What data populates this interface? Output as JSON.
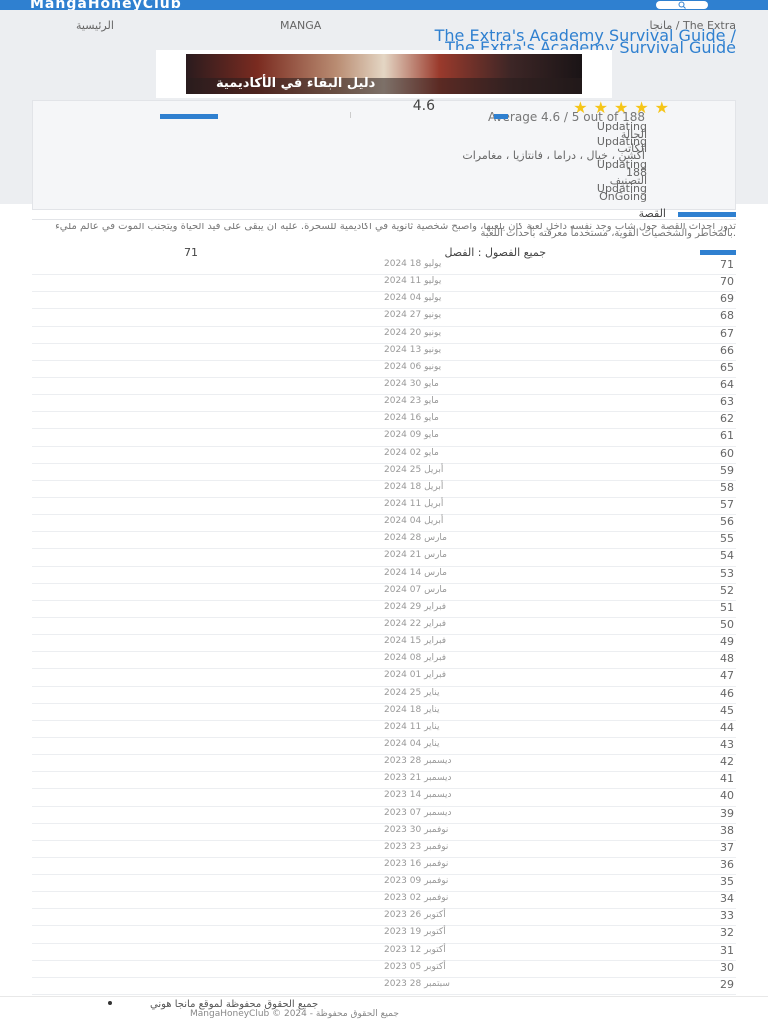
{
  "header": {
    "logo": "MangaHoneyClub",
    "accent": "#2f80d0"
  },
  "breadcrumb": {
    "home": "الرئيسية",
    "section": "MANGA",
    "current": "مانجا / The Extra"
  },
  "title": {
    "main": "The Extra's Academy Survival Guide /",
    "sub": "The Extra's Academy Survival Guide"
  },
  "cover": {
    "title": "دليل البقاء في الأكاديمية"
  },
  "rating": {
    "score": "4.6",
    "stars": "★★★★★",
    "average": "Average 4.6 / 5 out of 188"
  },
  "meta": {
    "lines": [
      "Updating",
      "الحالة",
      "Updating",
      "الكاتب",
      "Updating",
      "الرسام"
    ],
    "genres": "أكشن ، خيال ، دراما ، فانتازيا ، مغامرات",
    "lines2": [
      "Updating",
      "188",
      "التصنيف",
      "Updating",
      "OnGoing"
    ]
  },
  "sections": {
    "story_label": "القصة",
    "story_text": "تدور أحداث القصة حول شاب وجد نفسه داخل لعبة كان يلعبها، وأصبح شخصية ثانوية في أكاديمية للسحرة. عليه أن يبقى على قيد الحياة ويتجنب الموت في عالم مليء بالمخاطر والشخصيات القوية، مستخدماً معرفته بأحداث اللعبة.",
    "chapters_label": "جميع الفصول : الفصل",
    "chapters_count": "71"
  },
  "chapters": [
    {
      "num": "71",
      "date": "2024 يوليو 18"
    },
    {
      "num": "70",
      "date": "2024 يوليو 11"
    },
    {
      "num": "69",
      "date": "2024 يوليو 04"
    },
    {
      "num": "68",
      "date": "2024 يونيو 27"
    },
    {
      "num": "67",
      "date": "2024 يونيو 20"
    },
    {
      "num": "66",
      "date": "2024 يونيو 13"
    },
    {
      "num": "65",
      "date": "2024 يونيو 06"
    },
    {
      "num": "64",
      "date": "2024 مايو 30"
    },
    {
      "num": "63",
      "date": "2024 مايو 23"
    },
    {
      "num": "62",
      "date": "2024 مايو 16"
    },
    {
      "num": "61",
      "date": "2024 مايو 09"
    },
    {
      "num": "60",
      "date": "2024 مايو 02"
    },
    {
      "num": "59",
      "date": "2024 أبريل 25"
    },
    {
      "num": "58",
      "date": "2024 أبريل 18"
    },
    {
      "num": "57",
      "date": "2024 أبريل 11"
    },
    {
      "num": "56",
      "date": "2024 أبريل 04"
    },
    {
      "num": "55",
      "date": "2024 مارس 28"
    },
    {
      "num": "54",
      "date": "2024 مارس 21"
    },
    {
      "num": "53",
      "date": "2024 مارس 14"
    },
    {
      "num": "52",
      "date": "2024 مارس 07"
    },
    {
      "num": "51",
      "date": "2024 فبراير 29"
    },
    {
      "num": "50",
      "date": "2024 فبراير 22"
    },
    {
      "num": "49",
      "date": "2024 فبراير 15"
    },
    {
      "num": "48",
      "date": "2024 فبراير 08"
    },
    {
      "num": "47",
      "date": "2024 فبراير 01"
    },
    {
      "num": "46",
      "date": "2024 يناير 25"
    },
    {
      "num": "45",
      "date": "2024 يناير 18"
    },
    {
      "num": "44",
      "date": "2024 يناير 11"
    },
    {
      "num": "43",
      "date": "2024 يناير 04"
    },
    {
      "num": "42",
      "date": "2023 ديسمبر 28"
    },
    {
      "num": "41",
      "date": "2023 ديسمبر 21"
    },
    {
      "num": "40",
      "date": "2023 ديسمبر 14"
    },
    {
      "num": "39",
      "date": "2023 ديسمبر 07"
    },
    {
      "num": "38",
      "date": "2023 نوفمبر 30"
    },
    {
      "num": "37",
      "date": "2023 نوفمبر 23"
    },
    {
      "num": "36",
      "date": "2023 نوفمبر 16"
    },
    {
      "num": "35",
      "date": "2023 نوفمبر 09"
    },
    {
      "num": "34",
      "date": "2023 نوفمبر 02"
    },
    {
      "num": "33",
      "date": "2023 أكتوبر 26"
    },
    {
      "num": "32",
      "date": "2023 أكتوبر 19"
    },
    {
      "num": "31",
      "date": "2023 أكتوبر 12"
    },
    {
      "num": "30",
      "date": "2023 أكتوبر 05"
    },
    {
      "num": "29",
      "date": "2023 سبتمبر 28"
    }
  ],
  "footer": {
    "line1": "جميع الحقوق محفوظة لموقع مانجا هوني",
    "line2": "MangaHoneyClub © 2024 - جميع الحقوق محفوظة"
  }
}
